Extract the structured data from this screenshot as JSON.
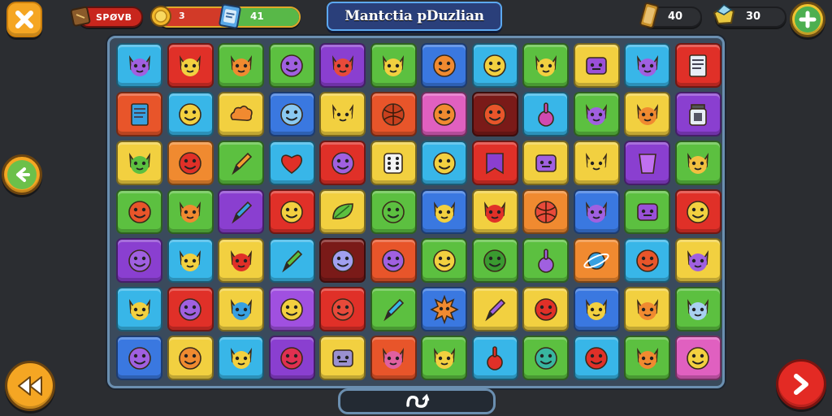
{
  "header": {
    "title": "Mantctia pDuzlian",
    "score_label": "SPØVB",
    "coin_value": "3",
    "progress_value": "41",
    "resource1_value": "40",
    "resource2_value": "30"
  },
  "bottom": {
    "symbol": "Ꝍ"
  },
  "colors": {
    "background": "#2b2d31",
    "board": "#3a4a5c",
    "accent_orange": "#f5a623",
    "accent_red": "#e32a24",
    "accent_green": "#4caf50",
    "title_blue": "#2a3f7a"
  },
  "board": {
    "rows": [
      [
        {
          "bg": "#38b6e8",
          "icon": "cat",
          "fg": "#a060e0"
        },
        {
          "bg": "#e03028",
          "icon": "cat",
          "fg": "#f2d040"
        },
        {
          "bg": "#5cc040",
          "icon": "cat",
          "fg": "#f08a30"
        },
        {
          "bg": "#5cc040",
          "icon": "smiley",
          "fg": "#a060e0"
        },
        {
          "bg": "#8a3fd0",
          "icon": "cat",
          "fg": "#e84a3a"
        },
        {
          "bg": "#5cc040",
          "icon": "cat",
          "fg": "#f2d040"
        },
        {
          "bg": "#3a78e0",
          "icon": "smiley",
          "fg": "#f08a30"
        },
        {
          "bg": "#38b6e8",
          "icon": "smiley",
          "fg": "#f2d040"
        },
        {
          "bg": "#5cc040",
          "icon": "cat",
          "fg": "#f2d040"
        },
        {
          "bg": "#f2d040",
          "icon": "box",
          "fg": "#9a50d8"
        },
        {
          "bg": "#38b6e8",
          "icon": "cat",
          "fg": "#a060e0"
        },
        {
          "bg": "#e03028",
          "icon": "card",
          "fg": "#e8eef6"
        }
      ],
      [
        {
          "bg": "#e8552a",
          "icon": "card",
          "fg": "#38a0e0"
        },
        {
          "bg": "#38b6e8",
          "icon": "smiley",
          "fg": "#f2d040"
        },
        {
          "bg": "#f2d040",
          "icon": "cloud",
          "fg": "#f08a30"
        },
        {
          "bg": "#3a78e0",
          "icon": "smiley",
          "fg": "#8ac8f0"
        },
        {
          "bg": "#f2d040",
          "icon": "cat",
          "fg": "#f2d040"
        },
        {
          "bg": "#e8552a",
          "icon": "ball",
          "fg": "#c8401e"
        },
        {
          "bg": "#e060c0",
          "icon": "smiley",
          "fg": "#f08a30"
        },
        {
          "bg": "#7a1a18",
          "icon": "smiley",
          "fg": "#e8552a"
        },
        {
          "bg": "#38b6e8",
          "icon": "pin",
          "fg": "#d04ab0"
        },
        {
          "bg": "#5cc040",
          "icon": "cat",
          "fg": "#a060e0"
        },
        {
          "bg": "#f2d040",
          "icon": "cat",
          "fg": "#f08a30"
        },
        {
          "bg": "#8a3fd0",
          "icon": "jar",
          "fg": "#e8eef6"
        }
      ],
      [
        {
          "bg": "#f2d040",
          "icon": "cat",
          "fg": "#5cc040"
        },
        {
          "bg": "#f08a30",
          "icon": "smiley",
          "fg": "#e03028"
        },
        {
          "bg": "#5cc040",
          "icon": "pen",
          "fg": "#f2a030"
        },
        {
          "bg": "#38b6e8",
          "icon": "heart",
          "fg": "#e03028"
        },
        {
          "bg": "#e03028",
          "icon": "smiley",
          "fg": "#a060e0"
        },
        {
          "bg": "#f2d040",
          "icon": "dice",
          "fg": "#f4f4f4"
        },
        {
          "bg": "#38b6e8",
          "icon": "smiley",
          "fg": "#f2d040"
        },
        {
          "bg": "#e03028",
          "icon": "flag",
          "fg": "#8a3fd0"
        },
        {
          "bg": "#f2d040",
          "icon": "box",
          "fg": "#a060e0"
        },
        {
          "bg": "#f2d040",
          "icon": "cat",
          "fg": "#f2d040"
        },
        {
          "bg": "#8a3fd0",
          "icon": "cup",
          "fg": "#c070f0"
        },
        {
          "bg": "#5cc040",
          "icon": "cat",
          "fg": "#f2c040"
        }
      ],
      [
        {
          "bg": "#5cc040",
          "icon": "smiley",
          "fg": "#e8552a"
        },
        {
          "bg": "#5cc040",
          "icon": "cat",
          "fg": "#f08a30"
        },
        {
          "bg": "#8a3fd0",
          "icon": "pen",
          "fg": "#38a0e0"
        },
        {
          "bg": "#e03028",
          "icon": "smiley",
          "fg": "#f2d040"
        },
        {
          "bg": "#f2d040",
          "icon": "leaf",
          "fg": "#5cc040"
        },
        {
          "bg": "#5cc040",
          "icon": "smiley",
          "fg": "#5cc040"
        },
        {
          "bg": "#3a78e0",
          "icon": "cat",
          "fg": "#f2d040"
        },
        {
          "bg": "#f2d040",
          "icon": "cat",
          "fg": "#e03028"
        },
        {
          "bg": "#f08a30",
          "icon": "ball",
          "fg": "#e84a3a"
        },
        {
          "bg": "#3a78e0",
          "icon": "cat",
          "fg": "#a060e0"
        },
        {
          "bg": "#5cc040",
          "icon": "box",
          "fg": "#9a50d8"
        },
        {
          "bg": "#e03028",
          "icon": "smiley",
          "fg": "#f2d040"
        }
      ],
      [
        {
          "bg": "#8a3fd0",
          "icon": "smiley",
          "fg": "#a060e0"
        },
        {
          "bg": "#38b6e8",
          "icon": "cat",
          "fg": "#f2d040"
        },
        {
          "bg": "#f2d040",
          "icon": "cat",
          "fg": "#e03028"
        },
        {
          "bg": "#38b6e8",
          "icon": "pen",
          "fg": "#5cc040"
        },
        {
          "bg": "#7a1a18",
          "icon": "smiley",
          "fg": "#a0a0f0"
        },
        {
          "bg": "#e8552a",
          "icon": "smiley",
          "fg": "#a060e0"
        },
        {
          "bg": "#5cc040",
          "icon": "smiley",
          "fg": "#f2d040"
        },
        {
          "bg": "#5cc040",
          "icon": "smiley",
          "fg": "#3a9a30"
        },
        {
          "bg": "#5cc040",
          "icon": "pin",
          "fg": "#a060e0"
        },
        {
          "bg": "#f08a30",
          "icon": "planet",
          "fg": "#38a0e0"
        },
        {
          "bg": "#38b6e8",
          "icon": "smiley",
          "fg": "#e8552a"
        },
        {
          "bg": "#f2d040",
          "icon": "cat",
          "fg": "#a060e0"
        }
      ],
      [
        {
          "bg": "#38b6e8",
          "icon": "cat",
          "fg": "#f2d040"
        },
        {
          "bg": "#e03028",
          "icon": "smiley",
          "fg": "#a060e0"
        },
        {
          "bg": "#f2d040",
          "icon": "cat",
          "fg": "#38a0e0"
        },
        {
          "bg": "#a050e0",
          "icon": "smiley",
          "fg": "#f2d040"
        },
        {
          "bg": "#e03028",
          "icon": "smiley",
          "fg": "#e84a3a"
        },
        {
          "bg": "#5cc040",
          "icon": "pen",
          "fg": "#38b6e8"
        },
        {
          "bg": "#3a78e0",
          "icon": "sun",
          "fg": "#f08a30"
        },
        {
          "bg": "#f2d040",
          "icon": "pen",
          "fg": "#a060e0"
        },
        {
          "bg": "#f2d040",
          "icon": "smiley",
          "fg": "#e03028"
        },
        {
          "bg": "#3a78e0",
          "icon": "cat",
          "fg": "#f2d040"
        },
        {
          "bg": "#f2d040",
          "icon": "cat",
          "fg": "#f08a30"
        },
        {
          "bg": "#5cc040",
          "icon": "cat",
          "fg": "#a8d0f0"
        }
      ],
      [
        {
          "bg": "#3a78e0",
          "icon": "smiley",
          "fg": "#a060e0"
        },
        {
          "bg": "#f2d040",
          "icon": "smiley",
          "fg": "#f08a30"
        },
        {
          "bg": "#38b6e8",
          "icon": "cat",
          "fg": "#f2d040"
        },
        {
          "bg": "#8a3fd0",
          "icon": "smiley",
          "fg": "#e03050"
        },
        {
          "bg": "#f2d040",
          "icon": "box",
          "fg": "#9a90d0"
        },
        {
          "bg": "#e8552a",
          "icon": "cat",
          "fg": "#e060a0"
        },
        {
          "bg": "#5cc040",
          "icon": "cat",
          "fg": "#f2d040"
        },
        {
          "bg": "#38b6e8",
          "icon": "pin",
          "fg": "#e03028"
        },
        {
          "bg": "#5cc040",
          "icon": "smiley",
          "fg": "#38b6a0"
        },
        {
          "bg": "#38b6e8",
          "icon": "smiley",
          "fg": "#e03028"
        },
        {
          "bg": "#5cc040",
          "icon": "cat",
          "fg": "#f08a30"
        },
        {
          "bg": "#e060c0",
          "icon": "smiley",
          "fg": "#f2d040"
        }
      ]
    ]
  }
}
